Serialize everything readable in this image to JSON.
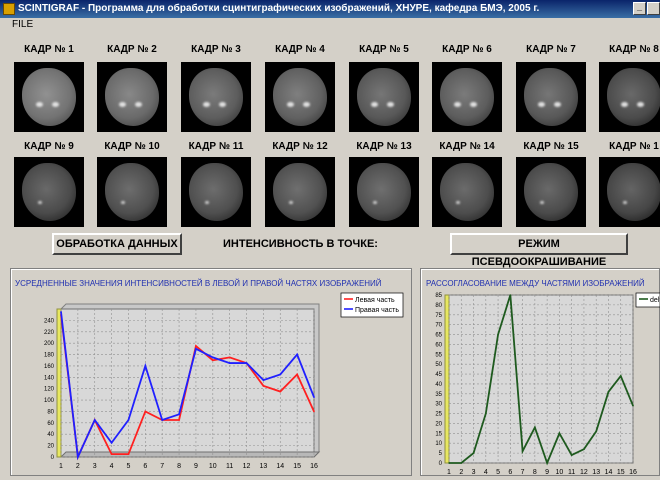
{
  "window": {
    "title": "SCINTIGRAF - Программа для обработки сцинтиграфических изображений,  ХНУРЕ, кафедра БМЭ, 2005 г.",
    "minimize_glyph": "_"
  },
  "menu": {
    "file": "FILE"
  },
  "frames": [
    {
      "label": "КАДР № 1"
    },
    {
      "label": "КАДР № 2"
    },
    {
      "label": "КАДР № 3"
    },
    {
      "label": "КАДР № 4"
    },
    {
      "label": "КАДР № 5"
    },
    {
      "label": "КАДР № 6"
    },
    {
      "label": "КАДР № 7"
    },
    {
      "label": "КАДР № 8"
    },
    {
      "label": "КАДР № 9"
    },
    {
      "label": "КАДР № 10"
    },
    {
      "label": "КАДР № 11"
    },
    {
      "label": "КАДР № 12"
    },
    {
      "label": "КАДР № 13"
    },
    {
      "label": "КАДР № 14"
    },
    {
      "label": "КАДР № 15"
    },
    {
      "label": "КАДР № 1"
    }
  ],
  "controls": {
    "process_button": "ОБРАБОТКА ДАННЫХ",
    "intensity_label": "ИНТЕНСИВНОСТЬ В ТОЧКЕ:",
    "pseudocolor_button": "РЕЖИМ ПСЕВДООКРАШИВАНИЕ"
  },
  "colors": {
    "left_series": "#ff2020",
    "right_series": "#2020ff",
    "mismatch_series": "#1e5a1e",
    "panel_title": "#2030b0"
  },
  "chart_data": [
    {
      "type": "line",
      "title": "УСРЕДНЕННЫЕ ЗНАЧЕНИЯ ИНТЕНСИВНОСТЕЙ В ЛЕВОЙ И ПРАВОЙ ЧАСТЯХ ИЗОБРАЖЕНИЙ",
      "x": [
        1,
        2,
        3,
        4,
        5,
        6,
        7,
        8,
        9,
        10,
        11,
        12,
        13,
        14,
        15,
        16
      ],
      "series": [
        {
          "name": "Левая часть",
          "values": [
            250,
            0,
            65,
            5,
            5,
            80,
            65,
            65,
            195,
            170,
            175,
            165,
            125,
            115,
            145,
            80
          ]
        },
        {
          "name": "Правая часть",
          "values": [
            255,
            0,
            65,
            25,
            65,
            160,
            65,
            75,
            190,
            175,
            165,
            165,
            135,
            145,
            180,
            105
          ]
        }
      ],
      "yticks": [
        0,
        20,
        40,
        60,
        80,
        100,
        120,
        140,
        160,
        180,
        200,
        220,
        240
      ],
      "ylim": [
        0,
        260
      ],
      "grid": true,
      "legend": "top-right"
    },
    {
      "type": "line",
      "title": "РАССОГЛАСОВАНИЕ МЕЖДУ ЧАСТЯМИ ИЗОБРАЖЕНИЙ",
      "x": [
        1,
        2,
        3,
        4,
        5,
        6,
        7,
        8,
        9,
        10,
        11,
        12,
        13,
        14,
        15,
        16
      ],
      "series": [
        {
          "name": "delta",
          "values": [
            0,
            0,
            5,
            25,
            65,
            85,
            6,
            18,
            0,
            15,
            4,
            7,
            16,
            36,
            44,
            29
          ]
        }
      ],
      "yticks": [
        0,
        5,
        10,
        15,
        20,
        25,
        30,
        35,
        40,
        45,
        50,
        55,
        60,
        65,
        70,
        75,
        80,
        85
      ],
      "ylim": [
        0,
        85
      ],
      "grid": true,
      "legend": "top-right"
    }
  ]
}
